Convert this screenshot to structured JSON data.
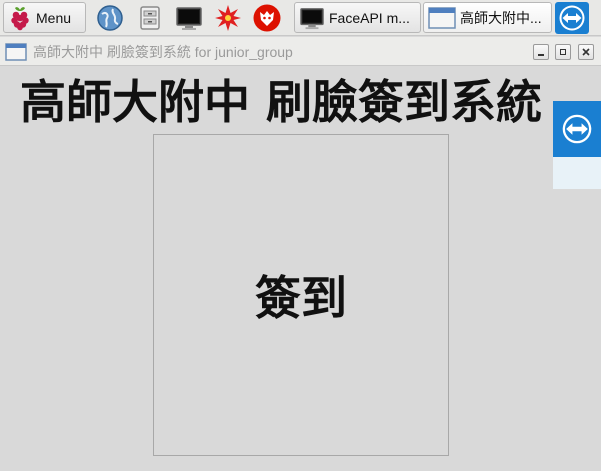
{
  "taskbar": {
    "menu_label": "Menu",
    "launchers": [
      {
        "icon": "web-browser-icon"
      },
      {
        "icon": "file-manager-icon"
      },
      {
        "icon": "terminal-icon"
      },
      {
        "icon": "burst-app-icon"
      },
      {
        "icon": "wolfram-icon"
      }
    ],
    "tasks": [
      {
        "label": "FaceAPI m...",
        "icon": "terminal-icon"
      },
      {
        "label": "高師大附中...",
        "icon": "window-icon"
      }
    ],
    "teamviewer_icon": "teamviewer-icon"
  },
  "window": {
    "title": "高師大附中 刷臉簽到系統 for junior_group",
    "controls": [
      "minimize",
      "maximize",
      "close"
    ]
  },
  "main": {
    "heading": "高師大附中 刷臉簽到系統",
    "checkin_label": "簽到"
  },
  "colors": {
    "background": "#d9d9d9",
    "teamviewer_blue": "#1a7fd1",
    "raspberry_red": "#c51a4a"
  }
}
